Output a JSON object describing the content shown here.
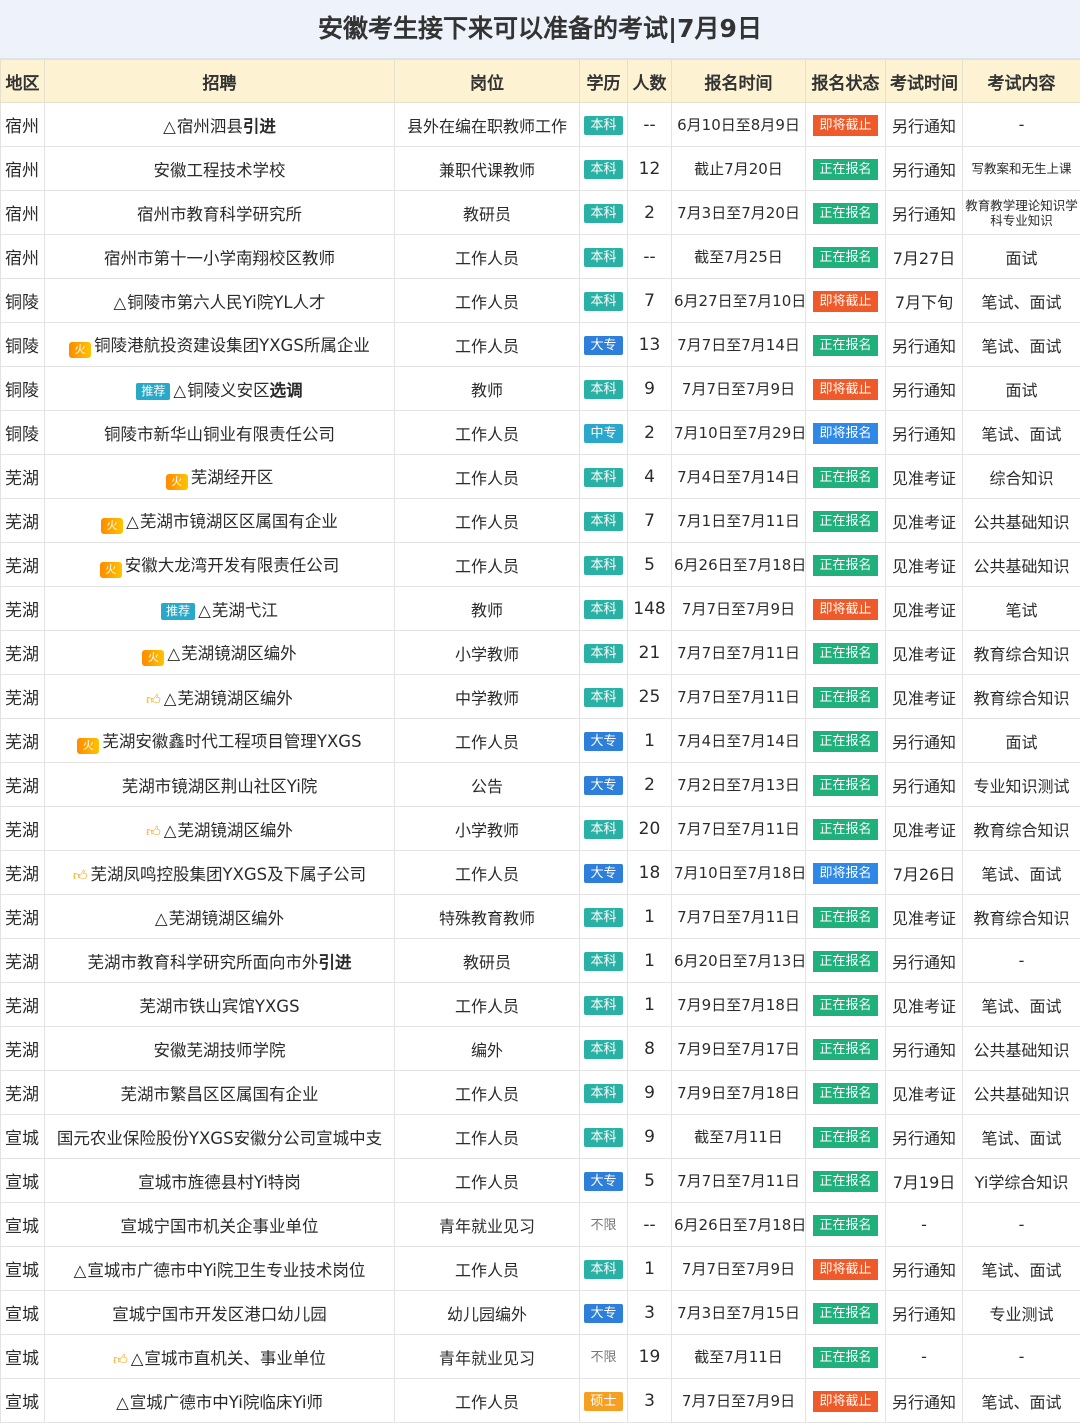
{
  "title": "安徽考生接下来可以准备的考试|7月9日",
  "headers": [
    "地区",
    "招聘",
    "岗位",
    "学历",
    "人数",
    "报名时间",
    "报名状态",
    "考试时间",
    "考试内容"
  ],
  "icons": {
    "fire": "fire-badge-icon",
    "thumb": "thumbs-up-icon",
    "warning": "warning-triangle-icon"
  },
  "recommend_tag": "推荐",
  "rows": [
    {
      "area": "宿州",
      "pre": "△",
      "name": "宿州泗县",
      "bold": "引进",
      "mark": "",
      "post": "县外在编在职教师工作",
      "edu": "本科",
      "edu_type": "bk",
      "num": "--",
      "time": "6月10日至8月9日",
      "status": "即将截止",
      "st_type": "end",
      "exam": "另行通知",
      "content": "-"
    },
    {
      "area": "宿州",
      "pre": "",
      "name": "安徽工程技术学校",
      "bold": "",
      "mark": "",
      "post": "兼职代课教师",
      "edu": "本科",
      "edu_type": "bk",
      "num": "12",
      "time": "截止7月20日",
      "status": "正在报名",
      "st_type": "now",
      "exam": "另行通知",
      "content": "写教案和无生上课",
      "small": true
    },
    {
      "area": "宿州",
      "pre": "",
      "name": "宿州市教育科学研究所",
      "bold": "",
      "mark": "",
      "post": "教研员",
      "edu": "本科",
      "edu_type": "bk",
      "num": "2",
      "time": "7月3日至7月20日",
      "status": "正在报名",
      "st_type": "now",
      "exam": "另行通知",
      "content": "教育教学理论知识学科专业知识",
      "small": true
    },
    {
      "area": "宿州",
      "pre": "",
      "name": "宿州市第十一小学南翔校区教师",
      "bold": "",
      "mark": "",
      "post": "工作人员",
      "edu": "本科",
      "edu_type": "bk",
      "num": "--",
      "time": "截至7月25日",
      "status": "正在报名",
      "st_type": "now",
      "exam": "7月27日",
      "content": "面试"
    },
    {
      "area": "铜陵",
      "pre": "△",
      "name": "铜陵市第六人民Yi院YL人才",
      "bold": "",
      "mark": "",
      "post": "工作人员",
      "edu": "本科",
      "edu_type": "bk",
      "num": "7",
      "time": "6月27日至7月10日",
      "status": "即将截止",
      "st_type": "end",
      "exam": "7月下旬",
      "content": "笔试、面试"
    },
    {
      "area": "铜陵",
      "pre": "",
      "name": "铜陵港航投资建设集团YXGS所属企业",
      "bold": "",
      "mark": "fire",
      "post": "工作人员",
      "edu": "大专",
      "edu_type": "dz",
      "num": "13",
      "time": "7月7日至7月14日",
      "status": "正在报名",
      "st_type": "now",
      "exam": "另行通知",
      "content": "笔试、面试"
    },
    {
      "area": "铜陵",
      "pre": "△",
      "name": "铜陵义安区",
      "bold": "选调",
      "mark": "tag",
      "post": "教师",
      "edu": "本科",
      "edu_type": "bk",
      "num": "9",
      "time": "7月7日至7月9日",
      "status": "即将截止",
      "st_type": "end",
      "exam": "另行通知",
      "content": "面试"
    },
    {
      "area": "铜陵",
      "pre": "",
      "name": "铜陵市新华山铜业有限责任公司",
      "bold": "",
      "mark": "",
      "post": "工作人员",
      "edu": "中专",
      "edu_type": "zz",
      "num": "2",
      "time": "7月10日至7月29日",
      "status": "即将报名",
      "st_type": "soon",
      "exam": "另行通知",
      "content": "笔试、面试"
    },
    {
      "area": "芜湖",
      "pre": "",
      "name": "芜湖经开区",
      "bold": "",
      "mark": "fire",
      "post": "工作人员",
      "edu": "本科",
      "edu_type": "bk",
      "num": "4",
      "time": "7月4日至7月14日",
      "status": "正在报名",
      "st_type": "now",
      "exam": "见准考证",
      "content": "综合知识"
    },
    {
      "area": "芜湖",
      "pre": "△",
      "name": "芜湖市镜湖区区属国有企业",
      "bold": "",
      "mark": "fire",
      "post": "工作人员",
      "edu": "本科",
      "edu_type": "bk",
      "num": "7",
      "time": "7月1日至7月11日",
      "status": "正在报名",
      "st_type": "now",
      "exam": "见准考证",
      "content": "公共基础知识"
    },
    {
      "area": "芜湖",
      "pre": "",
      "name": "安徽大龙湾开发有限责任公司",
      "bold": "",
      "mark": "fire",
      "post": "工作人员",
      "edu": "本科",
      "edu_type": "bk",
      "num": "5",
      "time": "6月26日至7月18日",
      "status": "正在报名",
      "st_type": "now",
      "exam": "见准考证",
      "content": "公共基础知识"
    },
    {
      "area": "芜湖",
      "pre": "△",
      "name": "芜湖弋江",
      "bold": "",
      "mark": "tag",
      "post": "教师",
      "edu": "本科",
      "edu_type": "bk",
      "num": "148",
      "time": "7月7日至7月9日",
      "status": "即将截止",
      "st_type": "end",
      "exam": "见准考证",
      "content": "笔试"
    },
    {
      "area": "芜湖",
      "pre": "△",
      "name": "芜湖镜湖区编外",
      "bold": "",
      "mark": "fire",
      "post": "小学教师",
      "edu": "本科",
      "edu_type": "bk",
      "num": "21",
      "time": "7月7日至7月11日",
      "status": "正在报名",
      "st_type": "now",
      "exam": "见准考证",
      "content": "教育综合知识"
    },
    {
      "area": "芜湖",
      "pre": "△",
      "name": "芜湖镜湖区编外",
      "bold": "",
      "mark": "thumb",
      "post": "中学教师",
      "edu": "本科",
      "edu_type": "bk",
      "num": "25",
      "time": "7月7日至7月11日",
      "status": "正在报名",
      "st_type": "now",
      "exam": "见准考证",
      "content": "教育综合知识"
    },
    {
      "area": "芜湖",
      "pre": "",
      "name": "芜湖安徽鑫时代工程项目管理YXGS",
      "bold": "",
      "mark": "fire",
      "post": "工作人员",
      "edu": "大专",
      "edu_type": "dz",
      "num": "1",
      "time": "7月4日至7月14日",
      "status": "正在报名",
      "st_type": "now",
      "exam": "另行通知",
      "content": "面试"
    },
    {
      "area": "芜湖",
      "pre": "",
      "name": "芜湖市镜湖区荆山社区Yi院",
      "bold": "",
      "mark": "",
      "post": "公告",
      "edu": "大专",
      "edu_type": "dz",
      "num": "2",
      "time": "7月2日至7月13日",
      "status": "正在报名",
      "st_type": "now",
      "exam": "另行通知",
      "content": "专业知识测试"
    },
    {
      "area": "芜湖",
      "pre": "△",
      "name": "芜湖镜湖区编外",
      "bold": "",
      "mark": "thumb",
      "post": "小学教师",
      "edu": "本科",
      "edu_type": "bk",
      "num": "20",
      "time": "7月7日至7月11日",
      "status": "正在报名",
      "st_type": "now",
      "exam": "见准考证",
      "content": "教育综合知识"
    },
    {
      "area": "芜湖",
      "pre": "",
      "name": "芜湖凤鸣控股集团YXGS及下属子公司",
      "bold": "",
      "mark": "thumb",
      "post": "工作人员",
      "edu": "大专",
      "edu_type": "dz",
      "num": "18",
      "time": "7月10日至7月18日",
      "status": "即将报名",
      "st_type": "soon",
      "exam": "7月26日",
      "content": "笔试、面试"
    },
    {
      "area": "芜湖",
      "pre": "△",
      "name": "芜湖镜湖区编外",
      "bold": "",
      "mark": "",
      "post": "特殊教育教师",
      "edu": "本科",
      "edu_type": "bk",
      "num": "1",
      "time": "7月7日至7月11日",
      "status": "正在报名",
      "st_type": "now",
      "exam": "见准考证",
      "content": "教育综合知识"
    },
    {
      "area": "芜湖",
      "pre": "",
      "name": "芜湖市教育科学研究所面向市外",
      "bold": "引进",
      "mark": "",
      "post": "教研员",
      "edu": "本科",
      "edu_type": "bk",
      "num": "1",
      "time": "6月20日至7月13日",
      "status": "正在报名",
      "st_type": "now",
      "exam": "另行通知",
      "content": "-"
    },
    {
      "area": "芜湖",
      "pre": "",
      "name": "芜湖市铁山宾馆YXGS",
      "bold": "",
      "mark": "",
      "post": "工作人员",
      "edu": "本科",
      "edu_type": "bk",
      "num": "1",
      "time": "7月9日至7月18日",
      "status": "正在报名",
      "st_type": "now",
      "exam": "见准考证",
      "content": "笔试、面试"
    },
    {
      "area": "芜湖",
      "pre": "",
      "name": "安徽芜湖技师学院",
      "bold": "",
      "mark": "",
      "post": "编外",
      "edu": "本科",
      "edu_type": "bk",
      "num": "8",
      "time": "7月9日至7月17日",
      "status": "正在报名",
      "st_type": "now",
      "exam": "另行通知",
      "content": "公共基础知识"
    },
    {
      "area": "芜湖",
      "pre": "",
      "name": "芜湖市繁昌区区属国有企业",
      "bold": "",
      "mark": "",
      "post": "工作人员",
      "edu": "本科",
      "edu_type": "bk",
      "num": "9",
      "time": "7月9日至7月18日",
      "status": "正在报名",
      "st_type": "now",
      "exam": "见准考证",
      "content": "公共基础知识"
    },
    {
      "area": "宣城",
      "pre": "",
      "name": "国元农业保险股份YXGS安徽分公司宣城中支",
      "bold": "",
      "mark": "",
      "post": "工作人员",
      "edu": "本科",
      "edu_type": "bk",
      "num": "9",
      "time": "截至7月11日",
      "status": "正在报名",
      "st_type": "now",
      "exam": "另行通知",
      "content": "笔试、面试"
    },
    {
      "area": "宣城",
      "pre": "",
      "name": "宣城市旌德县村Yi特岗",
      "bold": "",
      "mark": "",
      "post": "工作人员",
      "edu": "大专",
      "edu_type": "dz",
      "num": "5",
      "time": "7月7日至7月11日",
      "status": "正在报名",
      "st_type": "now",
      "exam": "7月19日",
      "content": "Yi学综合知识"
    },
    {
      "area": "宣城",
      "pre": "",
      "name": "宣城宁国市机关企事业单位",
      "bold": "",
      "mark": "",
      "post": "青年就业见习",
      "edu": "不限",
      "edu_type": "bx",
      "num": "--",
      "time": "6月26日至7月18日",
      "status": "正在报名",
      "st_type": "now",
      "exam": "-",
      "content": "-"
    },
    {
      "area": "宣城",
      "pre": "△",
      "name": "宣城市广德市中Yi院卫生专业技术岗位",
      "bold": "",
      "mark": "",
      "post": "工作人员",
      "edu": "本科",
      "edu_type": "bk",
      "num": "1",
      "time": "7月7日至7月9日",
      "status": "即将截止",
      "st_type": "end",
      "exam": "另行通知",
      "content": "笔试、面试"
    },
    {
      "area": "宣城",
      "pre": "",
      "name": "宣城宁国市开发区港口幼儿园",
      "bold": "",
      "mark": "",
      "post": "幼儿园编外",
      "edu": "大专",
      "edu_type": "dz",
      "num": "3",
      "time": "7月3日至7月15日",
      "status": "正在报名",
      "st_type": "now",
      "exam": "另行通知",
      "content": "专业测试"
    },
    {
      "area": "宣城",
      "pre": "△",
      "name": "宣城市直机关、事业单位",
      "bold": "",
      "mark": "thumb",
      "post": "青年就业见习",
      "edu": "不限",
      "edu_type": "bx",
      "num": "19",
      "time": "截至7月11日",
      "status": "正在报名",
      "st_type": "now",
      "exam": "-",
      "content": "-"
    },
    {
      "area": "宣城",
      "pre": "△",
      "name": "宣城广德市中Yi院临床Yi师",
      "bold": "",
      "mark": "",
      "post": "工作人员",
      "edu": "硕士",
      "edu_type": "ss",
      "num": "3",
      "time": "7月7日至7月9日",
      "status": "即将截止",
      "st_type": "end",
      "exam": "另行通知",
      "content": "笔试、面试"
    }
  ]
}
